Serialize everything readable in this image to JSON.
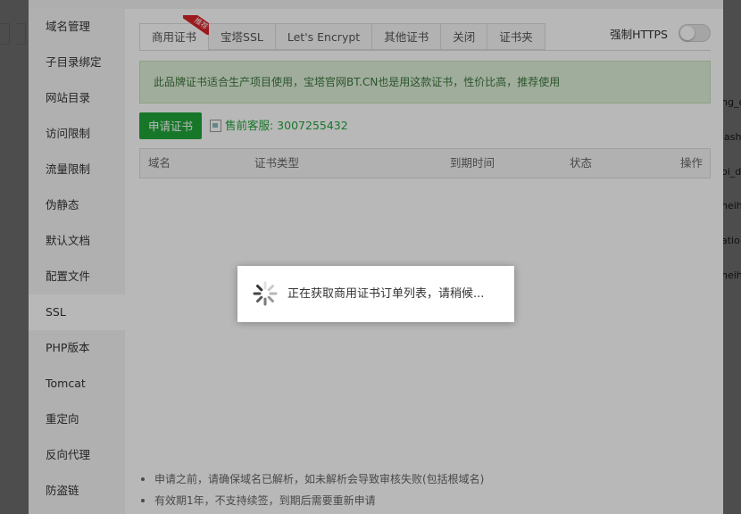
{
  "sidebar": {
    "items": [
      {
        "label": "域名管理"
      },
      {
        "label": "子目录绑定"
      },
      {
        "label": "网站目录"
      },
      {
        "label": "访问限制"
      },
      {
        "label": "流量限制"
      },
      {
        "label": "伪静态"
      },
      {
        "label": "默认文档"
      },
      {
        "label": "配置文件"
      },
      {
        "label": "SSL"
      },
      {
        "label": "PHP版本"
      },
      {
        "label": "Tomcat"
      },
      {
        "label": "重定向"
      },
      {
        "label": "反向代理"
      },
      {
        "label": "防盗链"
      }
    ],
    "active": "SSL"
  },
  "tabs": [
    {
      "label": "商用证书",
      "badge": "推荐"
    },
    {
      "label": "宝塔SSL"
    },
    {
      "label": "Let's Encrypt"
    },
    {
      "label": "其他证书"
    },
    {
      "label": "关闭"
    },
    {
      "label": "证书夹"
    }
  ],
  "force_https": {
    "label": "强制HTTPS",
    "enabled": false
  },
  "notice": "此品牌证书适合生产项目使用，宝塔官网BT.CN也是用这款证书，性价比高，推荐使用",
  "apply_button": "申请证书",
  "service": "售前客服: 3007255432",
  "table": {
    "columns": [
      "域名",
      "证书类型",
      "到期时间",
      "状态",
      "操作"
    ]
  },
  "tips": [
    "申请之前，请确保域名已解析，如未解析会导致审核失败(包括根域名)",
    "有效期1年，不支持续签，到期后需要重新申请"
  ],
  "loading": {
    "text": "正在获取商用证书订单列表，请稍候..."
  },
  "background": {
    "right_rows": [
      "ng_c",
      "lash",
      "oi_d",
      "neih",
      "atio",
      "neih"
    ]
  },
  "colors": {
    "accent": "#20a53a",
    "notice_bg": "#dff0d8",
    "badge": "#d9242a"
  }
}
